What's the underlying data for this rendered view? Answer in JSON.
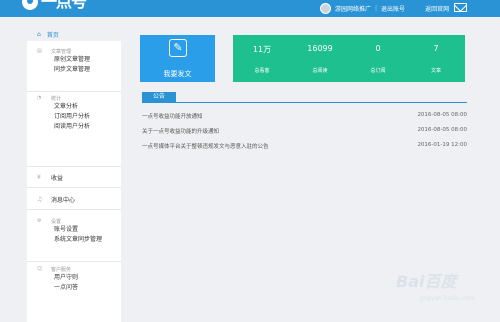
{
  "header": {
    "logo_text": "一点号",
    "username": "游园网络推广",
    "logout": "退出账号",
    "back_home": "返回官网"
  },
  "sidebar": {
    "home": "首页",
    "groups": [
      {
        "title": "文章管理",
        "items": [
          "原创文章管理",
          "同步文章管理"
        ]
      },
      {
        "title": "统计",
        "items": [
          "文章分析",
          "订阅用户分析",
          "阅读用户分析"
        ]
      },
      {
        "title": "收益",
        "items": []
      },
      {
        "title": "消息中心",
        "items": []
      },
      {
        "title": "设置",
        "items": [
          "账号设置",
          "系统文章同步管理"
        ]
      },
      {
        "title": "客户服务",
        "items": [
          "用户守则",
          "一点问答"
        ]
      }
    ]
  },
  "write": {
    "label": "我要发文"
  },
  "stats": [
    {
      "value": "11万",
      "label": "总看客"
    },
    {
      "value": "16099",
      "label": "总阅读"
    },
    {
      "value": "0",
      "label": "总订阅"
    },
    {
      "value": "7",
      "label": "文章"
    }
  ],
  "notices": {
    "tab": "公告",
    "rows": [
      {
        "title": "一点号收益功能开放通知",
        "date": "2016-08-05 08:00"
      },
      {
        "title": "关于一点号收益功能的升级通知",
        "date": "2016-08-05 08:00"
      },
      {
        "title": "一点号媒体平台关于整顿违规发文与恶意入驻的公告",
        "date": "2016-01-19 12:00"
      }
    ]
  },
  "watermark": {
    "big": "Bai百度",
    "small": "jingyan.baidu.com"
  },
  "colors": {
    "accent": "#2a93d5",
    "write_card": "#2a9ee8",
    "stats_card": "#1fc08f"
  }
}
